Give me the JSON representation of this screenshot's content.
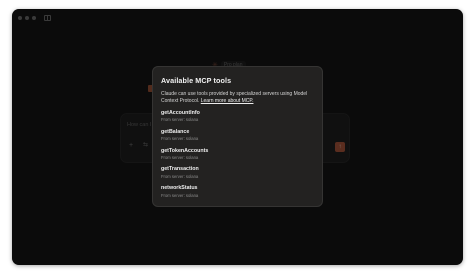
{
  "app": {
    "window_buttons": [
      "close",
      "minimize",
      "maximize"
    ],
    "sidebar_toggle_icon": "sidebar-icon"
  },
  "background": {
    "greeting_badge": "Pro plan",
    "composer": {
      "placeholder": "How can I help you today?",
      "add_icon": "plus-icon",
      "tools_icon": "sliders-icon",
      "send_icon": "arrow-up-icon"
    }
  },
  "modal": {
    "title": "Available MCP tools",
    "description": "Claude can use tools provided by specialized servers using Model Context Protocol.",
    "learn_more": "Learn more about MCP.",
    "tools": [
      {
        "name": "getAccountInfo",
        "server": "From server: solana"
      },
      {
        "name": "getBalance",
        "server": "From server: solana"
      },
      {
        "name": "getTokenAccounts",
        "server": "From server: solana"
      },
      {
        "name": "getTransaction",
        "server": "From server: solana"
      },
      {
        "name": "networkStatus",
        "server": "From server: solana"
      }
    ]
  },
  "colors": {
    "window_bg": "#121212",
    "modal_bg": "#232221",
    "accent": "#d97757"
  }
}
